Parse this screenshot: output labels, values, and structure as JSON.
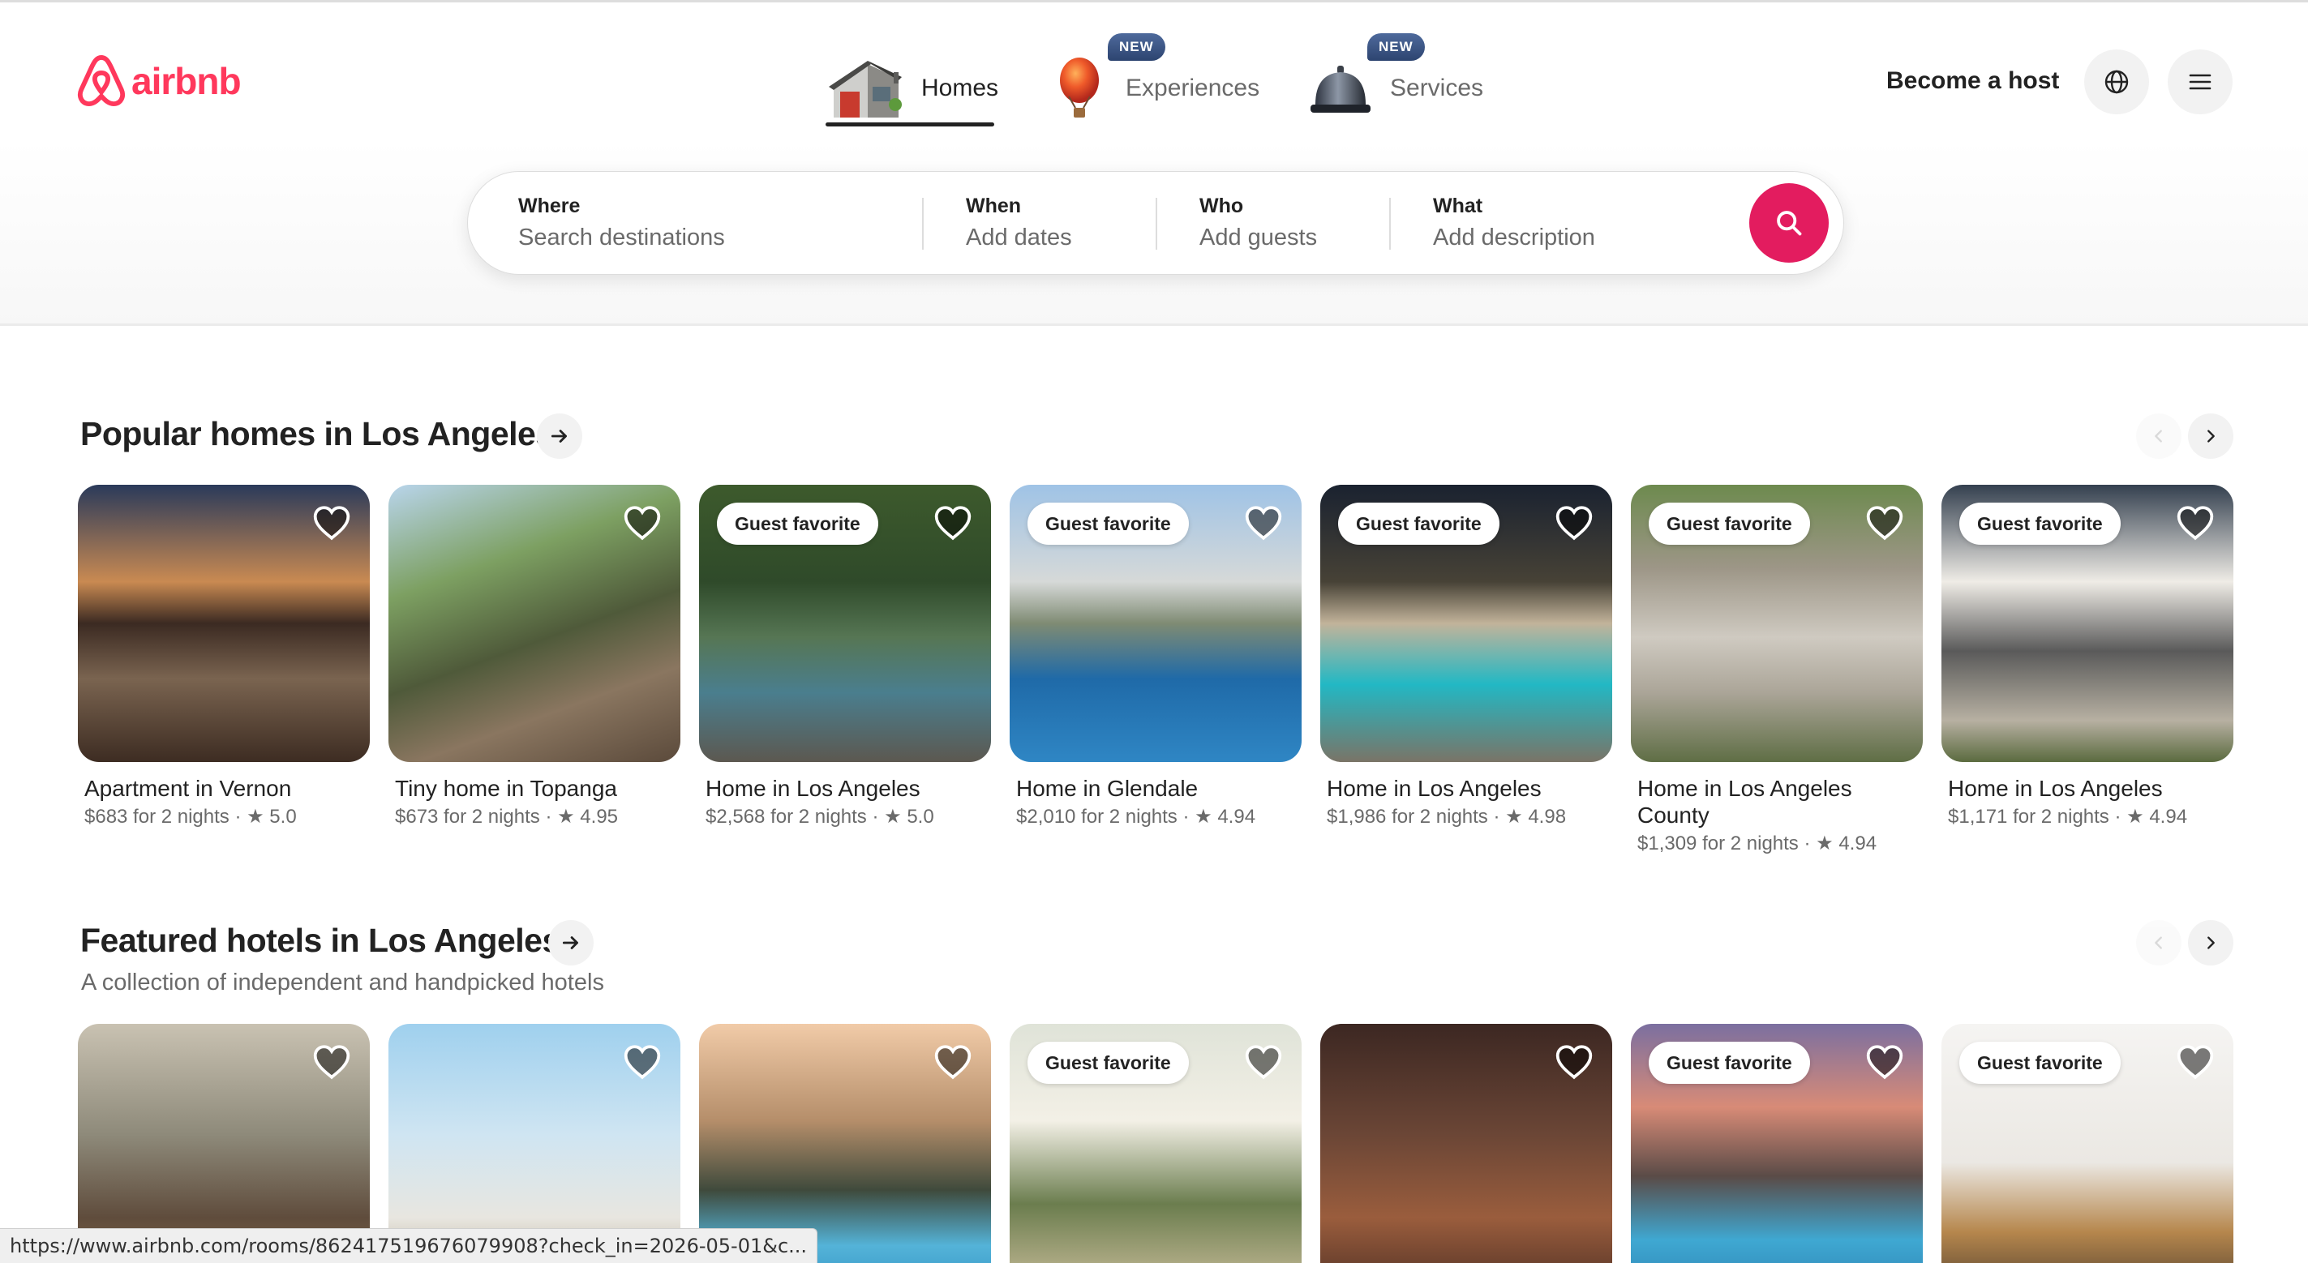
{
  "brand": {
    "name": "airbnb",
    "color": "#ff385c"
  },
  "nav": {
    "tabs": [
      {
        "label": "Homes",
        "active": true,
        "badge": ""
      },
      {
        "label": "Experiences",
        "active": false,
        "badge": "NEW"
      },
      {
        "label": "Services",
        "active": false,
        "badge": "NEW"
      }
    ],
    "become_host": "Become a host"
  },
  "search": {
    "where_label": "Where",
    "where_placeholder": "Search destinations",
    "when_label": "When",
    "when_placeholder": "Add dates",
    "who_label": "Who",
    "who_placeholder": "Add guests",
    "what_label": "What",
    "what_placeholder": "Add description",
    "button_color": "#e31c5f"
  },
  "sections": [
    {
      "title": "Popular homes in Los Angeles",
      "subtitle": "",
      "cards": [
        {
          "badge": "",
          "title": "Apartment in Vernon",
          "price": "$683 for 2 nights",
          "rating": "★ 5.0"
        },
        {
          "badge": "",
          "title": "Tiny home in Topanga",
          "price": "$673 for 2 nights",
          "rating": "★ 4.95"
        },
        {
          "badge": "Guest favorite",
          "title": "Home in Los Angeles",
          "price": "$2,568 for 2 nights",
          "rating": "★ 5.0"
        },
        {
          "badge": "Guest favorite",
          "title": "Home in Glendale",
          "price": "$2,010 for 2 nights",
          "rating": "★ 4.94"
        },
        {
          "badge": "Guest favorite",
          "title": "Home in Los Angeles",
          "price": "$1,986 for 2 nights",
          "rating": "★ 4.98"
        },
        {
          "badge": "Guest favorite",
          "title": "Home in Los Angeles County",
          "price": "$1,309 for 2 nights",
          "rating": "★ 4.94"
        },
        {
          "badge": "Guest favorite",
          "title": "Home in Los Angeles",
          "price": "$1,171 for 2 nights",
          "rating": "★ 4.94"
        }
      ]
    },
    {
      "title": "Featured hotels in Los Angeles",
      "subtitle": "A collection of independent and handpicked hotels",
      "cards": [
        {
          "badge": ""
        },
        {
          "badge": ""
        },
        {
          "badge": ""
        },
        {
          "badge": "Guest favorite"
        },
        {
          "badge": ""
        },
        {
          "badge": "Guest favorite"
        },
        {
          "badge": "Guest favorite"
        }
      ]
    }
  ],
  "status_bar": {
    "url": "https://www.airbnb.com/rooms/862417519676079908?check_in=2026-05-01&c..."
  }
}
